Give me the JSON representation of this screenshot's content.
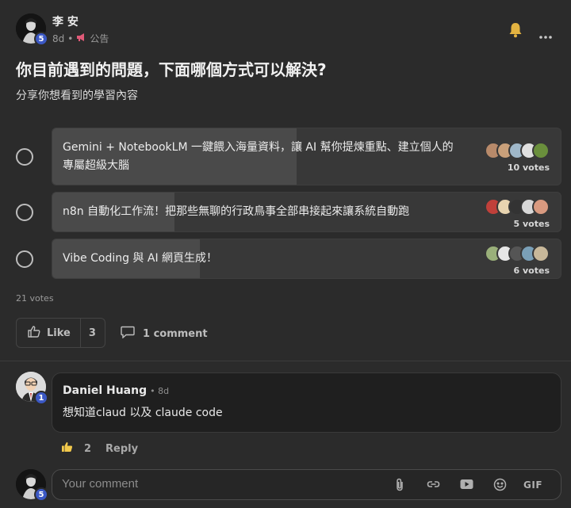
{
  "post": {
    "author": "李 安",
    "level": "5",
    "age": "8d",
    "category": "公告",
    "title": "你目前遇到的問題，下面哪個方式可以解決?",
    "body": "分享你想看到的學習內容"
  },
  "poll": {
    "options": [
      {
        "label_line1": "Gemini + NotebookLM 一鍵餵入海量資料，讓 AI 幫你提煉重點、建立個人的",
        "label_line2": "專屬超級大腦",
        "votes": "10 votes",
        "fill": 0.48,
        "voters": [
          "#b88a6a",
          "#c9a07a",
          "#9fb7c9",
          "#e0e0e0",
          "#6a8f3c"
        ]
      },
      {
        "label_line1": "n8n 自動化工作流！把那些無聊的行政鳥事全部串接起來讓系統自動跑",
        "label_line2": "",
        "votes": "5 votes",
        "fill": 0.24,
        "voters": [
          "#c0403a",
          "#e8d4b0",
          "#333333",
          "#d8d8d8",
          "#d99a80"
        ]
      },
      {
        "label_line1": "Vibe Coding 與 AI 網頁生成！",
        "label_line2": "",
        "votes": "6 votes",
        "fill": 0.29,
        "voters": [
          "#9ab07a",
          "#e6e6e6",
          "#555555",
          "#7aa0b8",
          "#c8b89a"
        ]
      }
    ],
    "total": "21 votes"
  },
  "actions": {
    "like_label": "Like",
    "like_count": "3",
    "comment_label": "1 comment"
  },
  "comment": {
    "author": "Daniel Huang",
    "time": "• 8d",
    "level": "1",
    "text": "想知道claud 以及 claude code",
    "likes": "2",
    "reply_label": "Reply"
  },
  "composer": {
    "placeholder": "Your comment",
    "level": "5",
    "gif_label": "GIF"
  },
  "colors": {
    "background": "#2b2b2b",
    "level_badge": "#3b58c4",
    "bell": "#e3b341",
    "like_icon": "#f2c94c"
  }
}
